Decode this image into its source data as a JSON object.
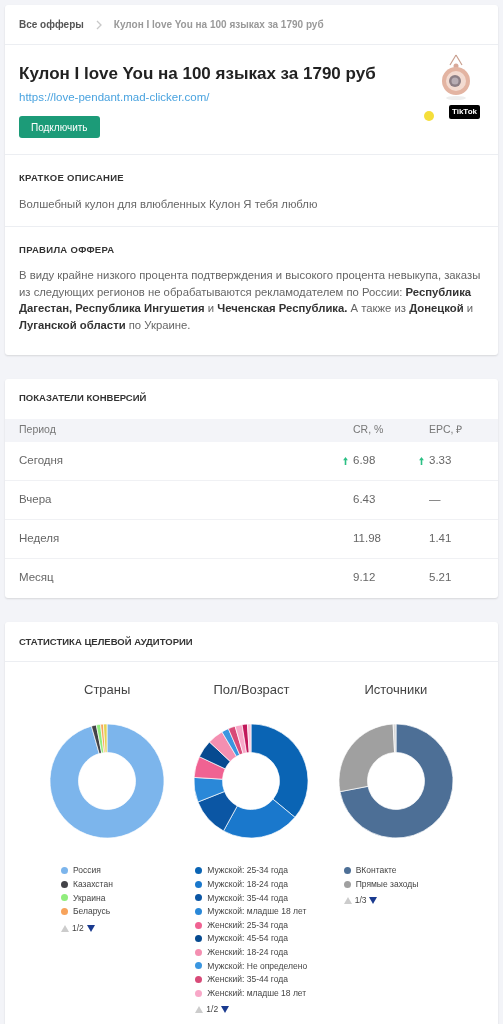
{
  "breadcrumb": {
    "link": "Все офферы",
    "current": "Кулон I love You на 100 языках за 1790 руб"
  },
  "offer": {
    "title": "Кулон I love You на 100 языках за 1790 руб",
    "url": "https://love-pendant.mad-clicker.com/",
    "button": "Подключить",
    "badge": "TikTok"
  },
  "sections": [
    {
      "heading": "КРАТКОЕ ОПИСАНИЕ",
      "text": "Волшебный кулон для влюбленных Кулон Я тебя люблю"
    },
    {
      "heading": "ПРАВИЛА ОФФЕРА",
      "text": "В виду крайне низкого процента подтверждения и высокого процента невыкупа, заказы из следующих регионов не обрабатываются рекламодателем по России: **Республика Дагестан, Республика Ингушетия** и **Чеченская Республика.** А также из **Донецкой** и **Луганской области** по Украине."
    }
  ],
  "conversions": {
    "title": "ПОКАЗАТЕЛИ КОНВЕРСИЙ",
    "columns": [
      "Период",
      "CR, %",
      "EPC, ₽"
    ],
    "rows": [
      {
        "period": "Сегодня",
        "cr": {
          "value": "6.98",
          "up": true
        },
        "epc": {
          "value": "3.33",
          "up": true
        }
      },
      {
        "period": "Вчера",
        "cr": {
          "value": "6.43",
          "up": false
        },
        "epc": {
          "value": "—",
          "up": false
        }
      },
      {
        "period": "Неделя",
        "cr": {
          "value": "11.98",
          "up": false
        },
        "epc": {
          "value": "1.41",
          "up": false
        }
      },
      {
        "period": "Месяц",
        "cr": {
          "value": "9.12",
          "up": false
        },
        "epc": {
          "value": "5.21",
          "up": false
        }
      }
    ]
  },
  "audience": {
    "title": "СТАТИСТИКА ЦЕЛЕВОЙ АУДИТОРИИ",
    "charts": [
      {
        "title": "Страны",
        "pager": "1/2",
        "legend": [
          {
            "label": "Россия",
            "color": "#7cb5ec"
          },
          {
            "label": "Казахстан",
            "color": "#434348"
          },
          {
            "label": "Украина",
            "color": "#90ed7d"
          },
          {
            "label": "Беларусь",
            "color": "#f7a35c"
          }
        ]
      },
      {
        "title": "Пол/Возраст",
        "pager": "1/2",
        "legend": [
          {
            "label": "Мужской: 25-34 года",
            "color": "#0a64b4"
          },
          {
            "label": "Мужской: 18-24 года",
            "color": "#1a78cc"
          },
          {
            "label": "Мужской: 35-44 года",
            "color": "#0b56a4"
          },
          {
            "label": "Мужской: младше 18 лет",
            "color": "#2a88d8"
          },
          {
            "label": "Женский: 25-34 года",
            "color": "#f06292"
          },
          {
            "label": "Мужской: 45-54 года",
            "color": "#064a90"
          },
          {
            "label": "Женский: 18-24 года",
            "color": "#f48fb1"
          },
          {
            "label": "Мужской: Не определено",
            "color": "#3a96e0"
          },
          {
            "label": "Женский: 35-44 года",
            "color": "#d84a78"
          },
          {
            "label": "Женский: младше 18 лет",
            "color": "#f8a8c8"
          }
        ]
      },
      {
        "title": "Источники",
        "pager": "1/3",
        "legend": [
          {
            "label": "ВКонтакте",
            "color": "#4d6f96"
          },
          {
            "label": "Прямые заходы",
            "color": "#a0a0a0"
          }
        ]
      }
    ]
  }
}
